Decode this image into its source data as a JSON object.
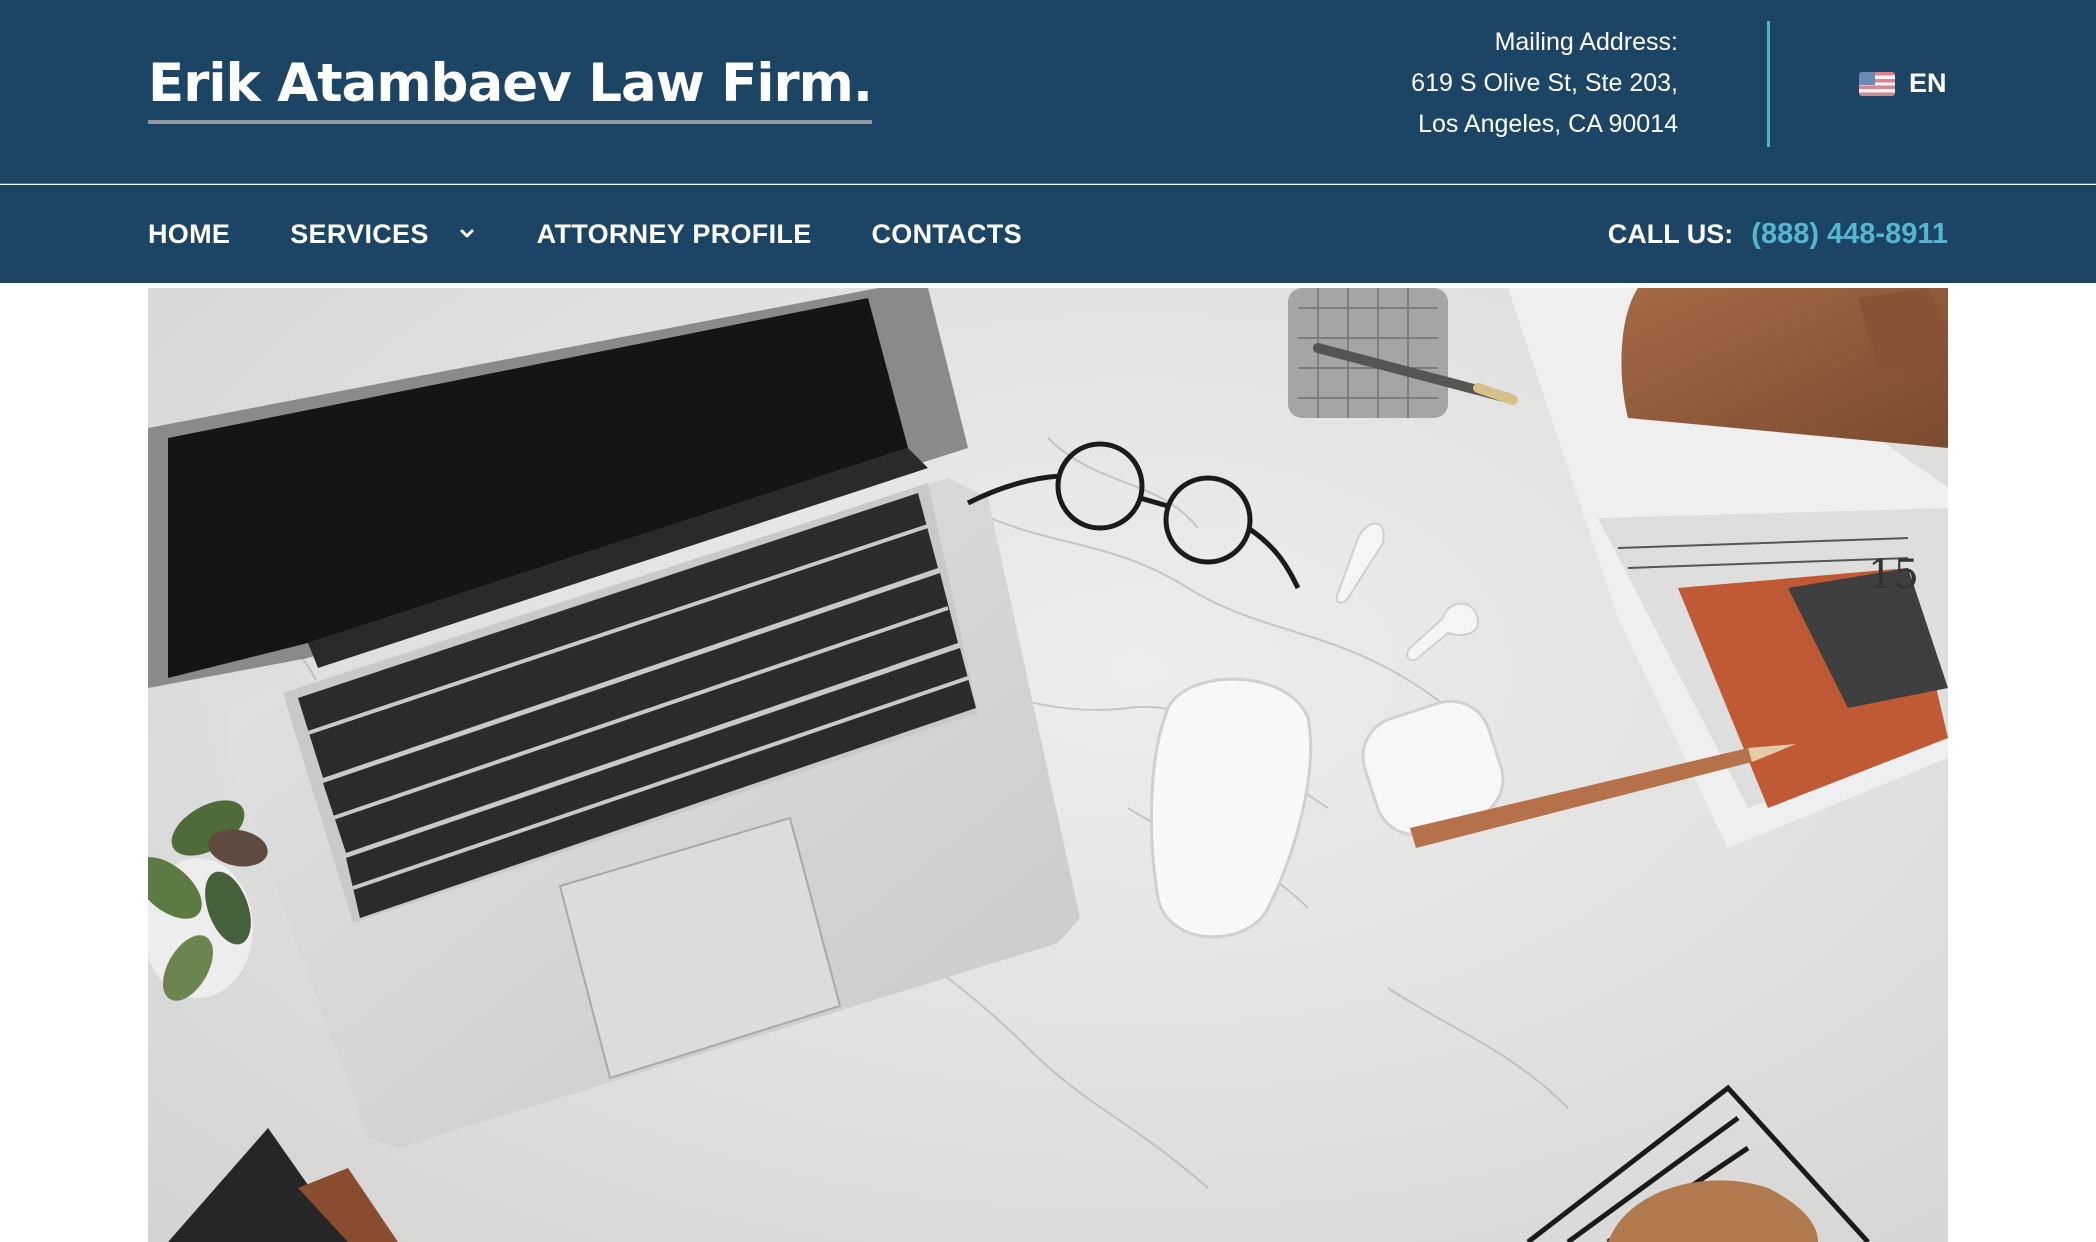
{
  "brand": {
    "name": "Erik Atambaev Law Firm."
  },
  "address": {
    "heading": "Mailing Address:",
    "line1": "619 S Olive St, Ste 203,",
    "line2": "Los Angeles, CA 90014"
  },
  "language": {
    "flag_icon": "us-flag-icon",
    "label": "EN"
  },
  "nav": {
    "items": [
      {
        "label": "HOME"
      },
      {
        "label": "SERVICES",
        "icon": "chevron-down-icon"
      },
      {
        "label": "ATTORNEY PROFILE"
      },
      {
        "label": "CONTACTS"
      }
    ]
  },
  "call": {
    "label": "CALL US:",
    "phone": "(888) 448-8911"
  },
  "hero": {
    "image": "desk-workspace-photo"
  },
  "colors": {
    "header_bg": "#1c4565",
    "accent": "#56b6cf",
    "text": "#ffffff"
  }
}
